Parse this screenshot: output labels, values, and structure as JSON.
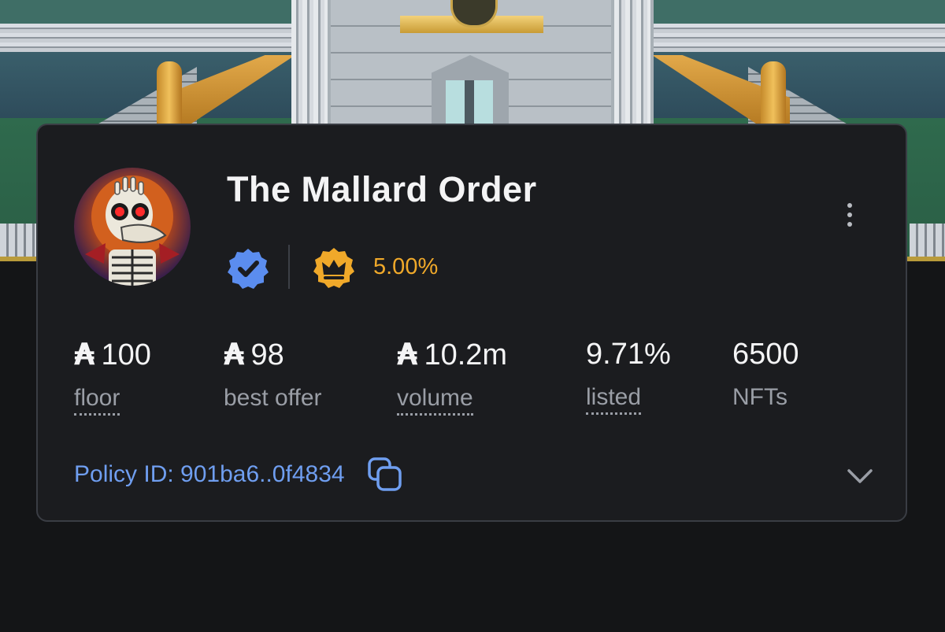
{
  "collection": {
    "name": "The Mallard Order",
    "royalty": "5.00%"
  },
  "stats": [
    {
      "value": "100",
      "label": "floor",
      "currency": "₳"
    },
    {
      "value": "98",
      "label": "best offer",
      "currency": "₳"
    },
    {
      "value": "10.2m",
      "label": "volume",
      "currency": "₳"
    },
    {
      "value": "9.71%",
      "label": "listed"
    },
    {
      "value": "6500",
      "label": "NFTs"
    }
  ],
  "policy": {
    "text": "Policy ID: 901ba6..0f4834"
  },
  "colors": {
    "accent": "#6f9ef0",
    "royalty": "#f0a92a",
    "card": "#1b1c1f",
    "verified": "#5b8def"
  },
  "icons": {
    "verified": "verified-badge-icon",
    "royalty": "crown-icon",
    "copy": "copy-icon",
    "menu": "more-vertical-icon",
    "expand": "chevron-down-icon"
  }
}
